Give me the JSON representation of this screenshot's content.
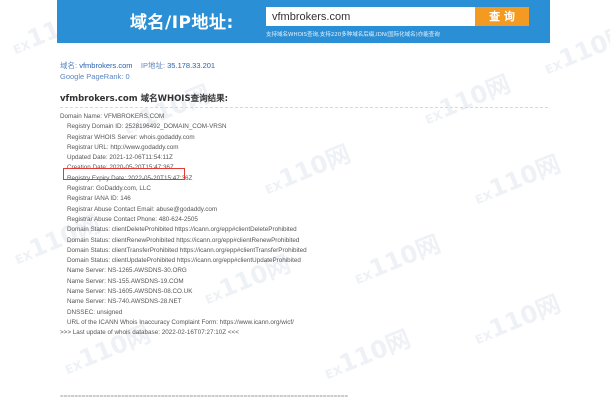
{
  "search": {
    "title": "域名/IP地址:",
    "query": "vfmbrokers.com",
    "button_label": "查 询",
    "subtitle": "支持域名WHOIS查询,支持220多种域名后缀,IDN(国际化域名)亦能查询"
  },
  "domain_info": {
    "domain_label": "域名:",
    "domain_value": "vfmbrokers.com",
    "ip_label": "IP地址:",
    "ip_value": "35.178.33.201",
    "pagerank_text": "Google PageRank: 0"
  },
  "result_heading": "vfmbrokers.com 域名WHOIS查询结果:",
  "whois_lines": [
    {
      "text": "Domain Name: VFMBROKERS.COM",
      "indent": false
    },
    {
      "text": "Registry Domain ID: 2528196492_DOMAIN_COM-VRSN",
      "indent": true
    },
    {
      "text": "Registrar WHOIS Server: whois.godaddy.com",
      "indent": true
    },
    {
      "text": "Registrar URL: http://www.godaddy.com",
      "indent": true
    },
    {
      "text": "Updated Date: 2021-12-06T11:54:11Z",
      "indent": true
    },
    {
      "text": "Creation Date: 2020-05-20T15:47:36Z",
      "indent": true,
      "highlighted": true
    },
    {
      "text": "Registry Expiry Date: 2022-05-20T15:47:36Z",
      "indent": true
    },
    {
      "text": "Registrar: GoDaddy.com, LLC",
      "indent": true
    },
    {
      "text": "Registrar IANA ID: 146",
      "indent": true
    },
    {
      "text": "Registrar Abuse Contact Email: abuse@godaddy.com",
      "indent": true
    },
    {
      "text": "Registrar Abuse Contact Phone: 480-624-2505",
      "indent": true
    },
    {
      "text": "Domain Status: clientDeleteProhibited https://icann.org/epp#clientDeleteProhibited",
      "indent": true
    },
    {
      "text": "Domain Status: clientRenewProhibited https://icann.org/epp#clientRenewProhibited",
      "indent": true
    },
    {
      "text": "Domain Status: clientTransferProhibited https://icann.org/epp#clientTransferProhibited",
      "indent": true
    },
    {
      "text": "Domain Status: clientUpdateProhibited https://icann.org/epp#clientUpdateProhibited",
      "indent": true
    },
    {
      "text": "Name Server: NS-1265.AWSDNS-30.ORG",
      "indent": true
    },
    {
      "text": "Name Server: NS-155.AWSDNS-19.COM",
      "indent": true
    },
    {
      "text": "Name Server: NS-1605.AWSDNS-08.CO.UK",
      "indent": true
    },
    {
      "text": "Name Server: NS-740.AWSDNS-28.NET",
      "indent": true
    },
    {
      "text": "DNSSEC: unsigned",
      "indent": true
    },
    {
      "text": "URL of the ICANN Whois Inaccuracy Complaint Form: https://www.icann.org/wicf/",
      "indent": true
    },
    {
      "text": ">>> Last update of whois database: 2022-02-16T07:27:10Z <<<",
      "indent": false
    }
  ],
  "separator_text": "================================================================================",
  "watermark_text": "110网",
  "colors": {
    "header_bg": "#2b8fd6",
    "button_bg": "#f39a23",
    "highlight_border": "#e53935",
    "link": "#2a62b0"
  }
}
